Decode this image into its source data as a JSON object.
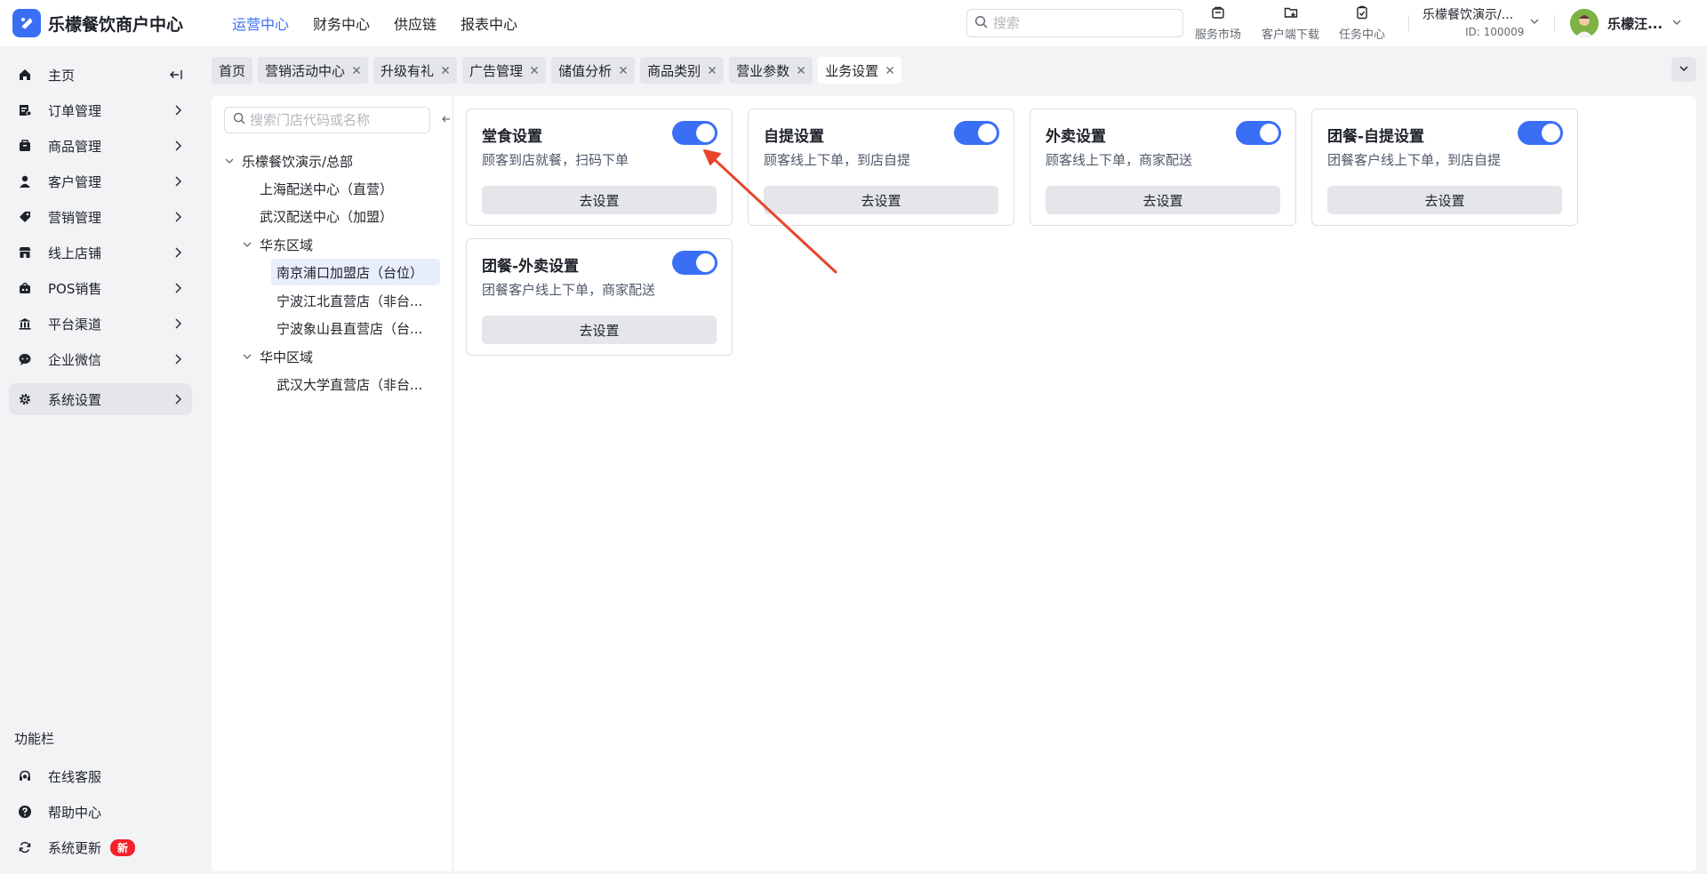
{
  "app": {
    "title": "乐檬餐饮商户中心"
  },
  "topnav": [
    {
      "label": "运营中心",
      "active": true
    },
    {
      "label": "财务中心"
    },
    {
      "label": "供应链"
    },
    {
      "label": "报表中心"
    }
  ],
  "search": {
    "placeholder": "搜索"
  },
  "header_tools": [
    {
      "label": "服务市场",
      "icon": "store-icon"
    },
    {
      "label": "客户端下载",
      "icon": "download-folder-icon"
    },
    {
      "label": "任务中心",
      "icon": "clipboard-icon"
    }
  ],
  "org": {
    "name": "乐檬餐饮演示/...",
    "id": "ID: 100009"
  },
  "user": {
    "name": "乐檬汪..."
  },
  "sidebar": {
    "items": [
      {
        "label": "主页",
        "icon": "home-icon"
      },
      {
        "label": "订单管理",
        "icon": "order-icon"
      },
      {
        "label": "商品管理",
        "icon": "goods-icon"
      },
      {
        "label": "客户管理",
        "icon": "user-icon"
      },
      {
        "label": "营销管理",
        "icon": "tag-icon"
      },
      {
        "label": "线上店铺",
        "icon": "shop-icon"
      },
      {
        "label": "POS销售",
        "icon": "pos-icon"
      },
      {
        "label": "平台渠道",
        "icon": "bank-icon"
      },
      {
        "label": "企业微信",
        "icon": "chat-icon"
      },
      {
        "label": "系统设置",
        "icon": "gear-icon",
        "active": true
      }
    ],
    "section_title": "功能栏",
    "footer_items": [
      {
        "label": "在线客服",
        "icon": "headset-icon"
      },
      {
        "label": "帮助中心",
        "icon": "help-icon"
      },
      {
        "label": "系统更新",
        "icon": "refresh-icon",
        "badge": "新"
      }
    ]
  },
  "tabs": [
    {
      "label": "首页",
      "closable": false
    },
    {
      "label": "营销活动中心",
      "closable": true
    },
    {
      "label": "升级有礼",
      "closable": true
    },
    {
      "label": "广告管理",
      "closable": true
    },
    {
      "label": "储值分析",
      "closable": true
    },
    {
      "label": "商品类别",
      "closable": true
    },
    {
      "label": "营业参数",
      "closable": true
    },
    {
      "label": "业务设置",
      "closable": true,
      "active": true
    }
  ],
  "tree": {
    "search_placeholder": "搜索门店代码或名称",
    "nodes": [
      {
        "label": "乐檬餐饮演示/总部",
        "expandable": true
      },
      {
        "label": "上海配送中心（直营）"
      },
      {
        "label": "武汉配送中心（加盟）"
      },
      {
        "label": "华东区域",
        "expandable": true
      },
      {
        "label": "南京浦口加盟店（台位）",
        "selected": true
      },
      {
        "label": "宁波江北直营店（非台..."
      },
      {
        "label": "宁波象山县直营店（台..."
      },
      {
        "label": "华中区域",
        "expandable": true
      },
      {
        "label": "武汉大学直营店（非台..."
      }
    ]
  },
  "cards": [
    {
      "title": "堂食设置",
      "desc": "顾客到店就餐，扫码下单",
      "enabled": true,
      "button": "去设置"
    },
    {
      "title": "自提设置",
      "desc": "顾客线上下单，到店自提",
      "enabled": true,
      "button": "去设置"
    },
    {
      "title": "外卖设置",
      "desc": "顾客线上下单，商家配送",
      "enabled": true,
      "button": "去设置"
    },
    {
      "title": "团餐-自提设置",
      "desc": "团餐客户线上下单，到店自提",
      "enabled": true,
      "button": "去设置"
    },
    {
      "title": "团餐-外卖设置",
      "desc": "团餐客户线上下单，商家配送",
      "enabled": true,
      "button": "去设置"
    }
  ],
  "colors": {
    "accent": "#3a6ff5",
    "annotation_arrow": "#e8452c",
    "badge": "#f5222d"
  }
}
